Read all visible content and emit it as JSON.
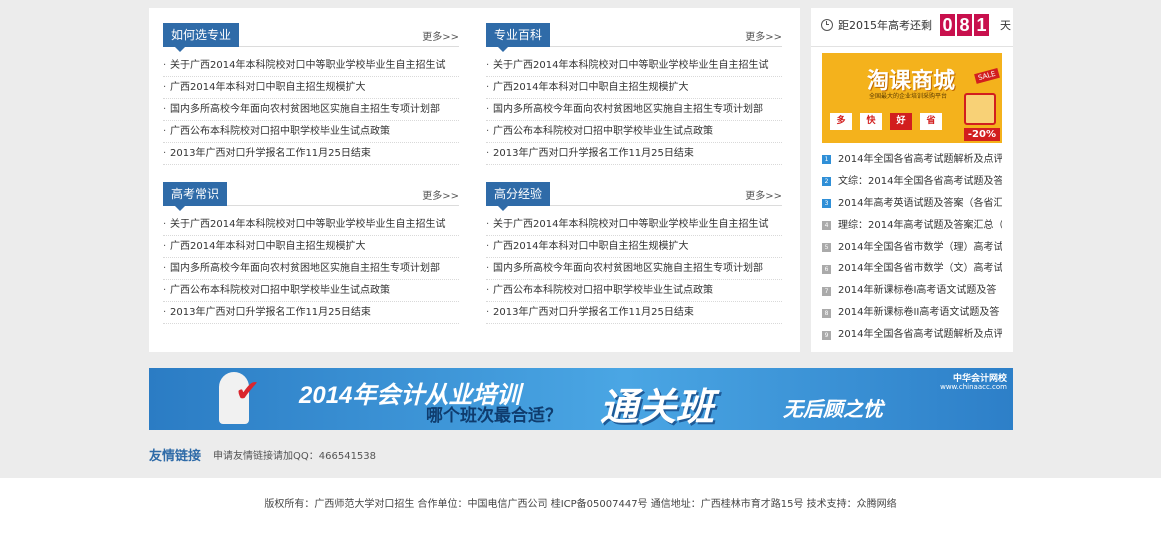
{
  "sections": [
    {
      "title": "如何选专业",
      "more": "更多>>",
      "items": [
        "关于广西2014年本科院校对口中等职业学校毕业生自主招生试",
        "广西2014年本科对口中职自主招生规模扩大",
        "国内多所高校今年面向农村贫困地区实施自主招生专项计划部",
        "广西公布本科院校对口招中职学校毕业生试点政策",
        "2013年广西对口升学报名工作11月25日结束"
      ]
    },
    {
      "title": "专业百科",
      "more": "更多>>",
      "items": [
        "关于广西2014年本科院校对口中等职业学校毕业生自主招生试",
        "广西2014年本科对口中职自主招生规模扩大",
        "国内多所高校今年面向农村贫困地区实施自主招生专项计划部",
        "广西公布本科院校对口招中职学校毕业生试点政策",
        "2013年广西对口升学报名工作11月25日结束"
      ]
    },
    {
      "title": "高考常识",
      "more": "更多>>",
      "items": [
        "关于广西2014年本科院校对口中等职业学校毕业生自主招生试",
        "广西2014年本科对口中职自主招生规模扩大",
        "国内多所高校今年面向农村贫困地区实施自主招生专项计划部",
        "广西公布本科院校对口招中职学校毕业生试点政策",
        "2013年广西对口升学报名工作11月25日结束"
      ]
    },
    {
      "title": "高分经验",
      "more": "更多>>",
      "items": [
        "关于广西2014年本科院校对口中等职业学校毕业生自主招生试",
        "广西2014年本科对口中职自主招生规模扩大",
        "国内多所高校今年面向农村贫困地区实施自主招生专项计划部",
        "广西公布本科院校对口招中职学校毕业生试点政策",
        "2013年广西对口升学报名工作11月25日结束"
      ]
    }
  ],
  "countdown": {
    "label": "距2015年高考还剩",
    "digits": [
      "0",
      "8",
      "1"
    ],
    "unit": "天",
    "digit_color": "#c8104d"
  },
  "ad": {
    "title": "淘课商城",
    "subtitle": "全国最大的企业培训采购平台",
    "chips": [
      "多",
      "快",
      "好",
      "省"
    ],
    "sale": "SALE",
    "discount": "-20%"
  },
  "rank": {
    "items": [
      {
        "num": "1",
        "text": "2014年全国各省高考试题解析及点评"
      },
      {
        "num": "2",
        "text": "文综：2014年全国各省高考试题及答"
      },
      {
        "num": "3",
        "text": "2014年高考英语试题及答案（各省汇"
      },
      {
        "num": "4",
        "text": "理综：2014年高考试题及答案汇总（"
      },
      {
        "num": "5",
        "text": "2014年全国各省市数学（理）高考试"
      },
      {
        "num": "6",
        "text": "2014年全国各省市数学（文）高考试"
      },
      {
        "num": "7",
        "text": "2014年新课标卷I高考语文试题及答"
      },
      {
        "num": "8",
        "text": "2014年新课标卷II高考语文试题及答"
      },
      {
        "num": "9",
        "text": "2014年全国各省高考试题解析及点评"
      }
    ]
  },
  "banner": {
    "line1": "2014年会计从业培训",
    "line2": "哪个班次最合适？",
    "big": "通关班",
    "end": "无后顾之忧",
    "logo": "中华会计网校",
    "logo_sub": "www.chinaacc.com"
  },
  "links": {
    "title": "友情链接",
    "text": "申请友情链接请加QQ：466541538"
  },
  "footer": {
    "text": "版权所有：广西师范大学对口招生  合作单位：中国电信广西公司  桂ICP备05007447号  通信地址：广西桂林市育才路15号  技术支持：众腾网络"
  },
  "colors": {
    "accent": "#2f6ba8",
    "background": "#ececec"
  }
}
